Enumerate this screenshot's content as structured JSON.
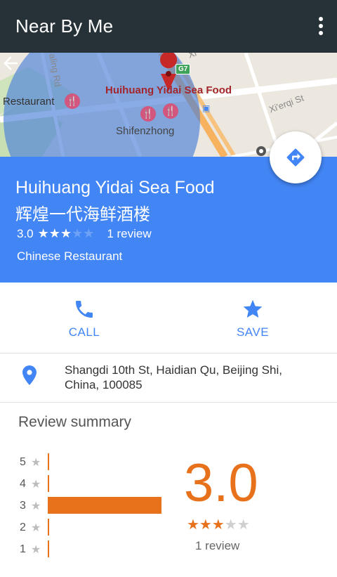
{
  "app_bar": {
    "title": "Near By Me",
    "menu_icon": "more-vert-icon"
  },
  "map": {
    "labels": {
      "restaurant": "Restaurant",
      "selected_place": "Huihuang Yidai Sea Food",
      "area": "Shifenzhong",
      "street_xierqi": "Xi'erqi St",
      "street_ling": "aling Rd",
      "street_top": "Xi",
      "highway": "G7"
    },
    "back_icon": "arrow-back-icon",
    "directions_icon": "directions-icon"
  },
  "place": {
    "name_en": "Huihuang Yidai Sea Food",
    "name_zh": "辉煌一代海鲜酒楼",
    "rating": "3.0",
    "rating_value": 3.0,
    "stars_on": "★★★",
    "stars_off": "★★",
    "review_count": "1 review",
    "category": "Chinese Restaurant"
  },
  "actions": {
    "call_label": "CALL",
    "save_label": "SAVE"
  },
  "address": {
    "text": "Shangdi 10th St, Haidian Qu, Beijing Shi, China, 100085"
  },
  "review_summary": {
    "title": "Review summary",
    "average": "3.0",
    "stars_on": "★★★",
    "stars_off": "★★",
    "count": "1 review",
    "distribution": [
      {
        "stars": "5",
        "count": 0
      },
      {
        "stars": "4",
        "count": 0
      },
      {
        "stars": "3",
        "count": 1
      },
      {
        "stars": "2",
        "count": 0
      },
      {
        "stars": "1",
        "count": 0
      }
    ]
  },
  "colors": {
    "app_bar": "#263238",
    "accent_blue": "#4285f4",
    "rating_orange": "#e8711c"
  }
}
